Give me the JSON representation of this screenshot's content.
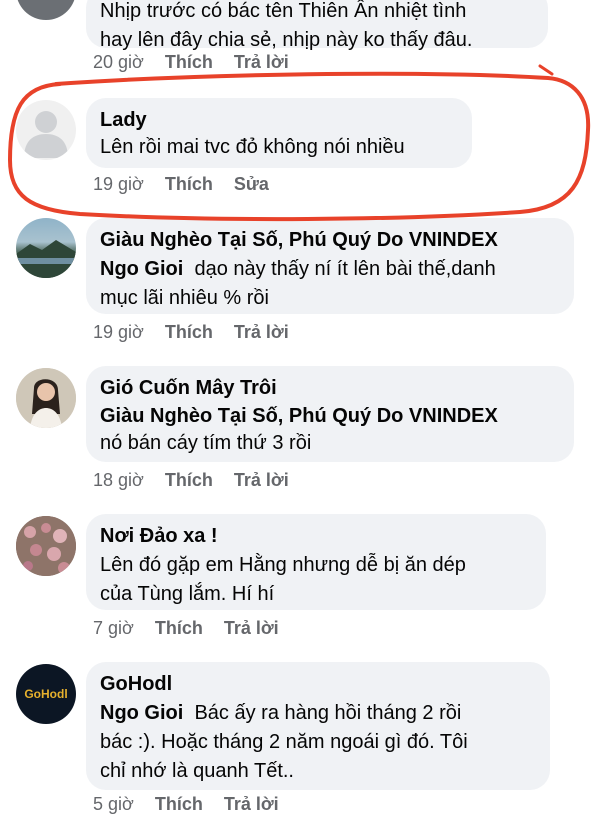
{
  "comments": [
    {
      "author": "",
      "text_lines": [
        "Nhịp trước có bác tên Thiên Ân nhiệt tình",
        "hay lên đây chia sẻ, nhịp này ko thấy đâu."
      ],
      "time": "20 giờ",
      "like": "Thích",
      "reply": "Trả lời"
    },
    {
      "author": "Lady",
      "text": "Lên rồi mai tvc đỏ không nói nhiều",
      "time": "19 giờ",
      "like": "Thích",
      "edit": "Sửa"
    },
    {
      "author": "Giàu Nghèo Tại Số, Phú Quý Do VNINDEX",
      "mention": "Ngo Gioi",
      "text_first": "dạo này thấy ní ít lên bài thế,danh",
      "text_rest": "mục lãi nhiêu % rồi",
      "time": "19 giờ",
      "like": "Thích",
      "reply": "Trả lời"
    },
    {
      "author": "Gió Cuốn Mây Trôi",
      "mention_line": "Giàu Nghèo Tại Số, Phú Quý Do VNINDEX",
      "text": "nó bán cáy tím thứ 3 rồi",
      "time": "18 giờ",
      "like": "Thích",
      "reply": "Trả lời"
    },
    {
      "author": "Nơi Đảo xa !",
      "text_lines": [
        "Lên đó gặp em Hằng nhưng dễ bị ăn dép",
        "của Tùng lắm. Hí hí"
      ],
      "time": "7 giờ",
      "like": "Thích",
      "reply": "Trả lời"
    },
    {
      "author": "GoHodl",
      "avatar_text": "GoHodl",
      "mention": "Ngo Gioi",
      "text_first": "Bác ấy ra hàng hồi tháng 2 rồi",
      "text_lines": [
        "bác :). Hoặc tháng 2 năm ngoái gì đó. Tôi",
        "chỉ nhớ là quanh Tết.."
      ],
      "time": "5 giờ",
      "like": "Thích",
      "reply": "Trả lời"
    }
  ],
  "colors": {
    "bubble": "#f0f2f5",
    "meta": "#65676b",
    "highlight_ring": "#e8422a",
    "text": "#050505"
  }
}
